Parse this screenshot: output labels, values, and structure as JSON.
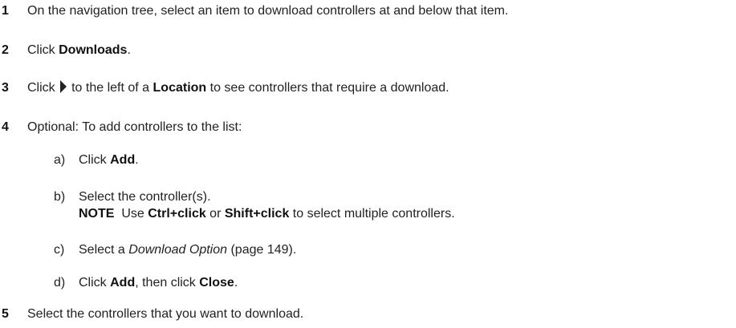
{
  "steps": [
    {
      "number": "1",
      "text": "On the navigation tree, select an item to download controllers at and below that item."
    },
    {
      "number": "2",
      "pre": "Click ",
      "bold": "Downloads",
      "post": "."
    },
    {
      "number": "3",
      "pre": "Click ",
      "icon": "expand-triangle-icon",
      "mid": "to the left of a ",
      "bold": "Location",
      "post": " to see controllers that require a download."
    },
    {
      "number": "4",
      "text": "Optional:  To add controllers to the list:",
      "substeps": [
        {
          "letter": "a)",
          "pre": "Click ",
          "bold": "Add",
          "post": "."
        },
        {
          "letter": "b)",
          "text": "Select the controller(s).",
          "note_label": "NOTE",
          "note_pre": "  Use ",
          "note_bold1": "Ctrl+click",
          "note_mid": " or ",
          "note_bold2": "Shift+click",
          "note_post": " to select multiple controllers."
        },
        {
          "letter": "c)",
          "pre": "Select a ",
          "italic": "Download Option",
          "post": " (page 149)."
        },
        {
          "letter": "d)",
          "pre": "Click ",
          "bold1": "Add",
          "mid": ", then click ",
          "bold2": "Close",
          "post": "."
        }
      ]
    },
    {
      "number": "5",
      "text": "Select the controllers that you want to download."
    }
  ],
  "colors": {
    "text": "#222222",
    "icon": "#222222"
  }
}
